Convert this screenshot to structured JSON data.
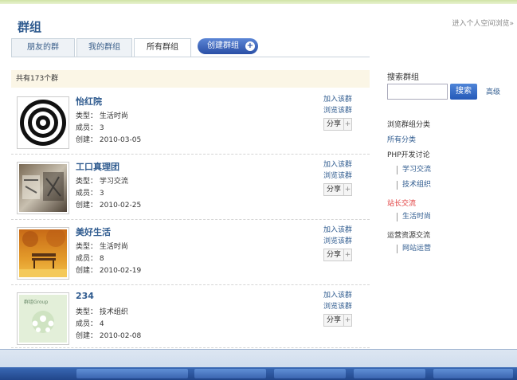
{
  "header": {
    "title": "群组",
    "enter_link": "进入个人空间浏览»"
  },
  "tabs": [
    {
      "label": "朋友的群"
    },
    {
      "label": "我的群组"
    },
    {
      "label": "所有群组"
    }
  ],
  "create_button": {
    "label": "创建群组",
    "icon": "plus-icon"
  },
  "count_text": "共有173个群",
  "groups": [
    {
      "name": "怡红院",
      "type_label": "类型：",
      "type": "生活时尚",
      "members_label": "成员：",
      "members": "3",
      "created_label": "创建：",
      "created": "2010-03-05",
      "join": "加入该群",
      "browse": "浏览该群",
      "share": "分享",
      "share_plus": "+"
    },
    {
      "name": "工口真理团",
      "type_label": "类型：",
      "type": "学习交流",
      "members_label": "成员：",
      "members": "3",
      "created_label": "创建：",
      "created": "2010-02-25",
      "join": "加入该群",
      "browse": "浏览该群",
      "share": "分享",
      "share_plus": "+"
    },
    {
      "name": "美好生活",
      "type_label": "类型：",
      "type": "生活时尚",
      "members_label": "成员：",
      "members": "8",
      "created_label": "创建：",
      "created": "2010-02-19",
      "join": "加入该群",
      "browse": "浏览该群",
      "share": "分享",
      "share_plus": "+"
    },
    {
      "name": "234",
      "type_label": "类型：",
      "type": "技术组织",
      "members_label": "成员：",
      "members": "4",
      "created_label": "创建：",
      "created": "2010-02-08",
      "join": "加入该群",
      "browse": "浏览该群",
      "share": "分享",
      "share_plus": "+",
      "thumb_text": "群组Group"
    }
  ],
  "sidebar": {
    "search_label": "搜索群组",
    "search_value": "",
    "search_button": "搜索",
    "advanced": "高级",
    "categories_title": "浏览群组分类",
    "all": "所有分类",
    "cat_php": "PHP开发讨论",
    "sub_learning": "学习交流",
    "sub_tech": "技术组织",
    "cat_admin": "站长交流",
    "sub_life": "生活时尚",
    "cat_ops": "运营资源交流",
    "sub_web": "网站运营"
  },
  "colors": {
    "accent": "#2f5b8f",
    "highlight": "#e03c3c",
    "count_bar": "#fbf6e6"
  }
}
